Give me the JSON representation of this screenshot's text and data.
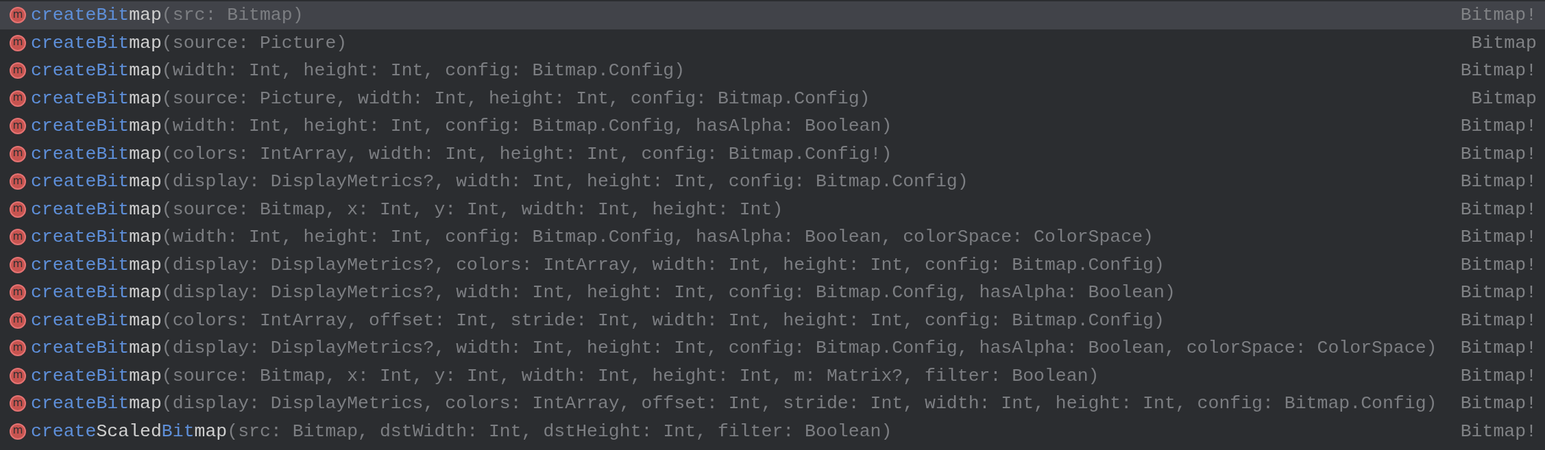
{
  "completion_list": {
    "items": [
      {
        "selected": true,
        "icon": "m",
        "name": [
          {
            "text": "createBit",
            "matched": true
          },
          {
            "text": "map",
            "matched": false
          }
        ],
        "params": "(src: Bitmap)",
        "type": "Bitmap!"
      },
      {
        "selected": false,
        "icon": "m",
        "name": [
          {
            "text": "createBit",
            "matched": true
          },
          {
            "text": "map",
            "matched": false
          }
        ],
        "params": "(source: Picture)",
        "type": "Bitmap"
      },
      {
        "selected": false,
        "icon": "m",
        "name": [
          {
            "text": "createBit",
            "matched": true
          },
          {
            "text": "map",
            "matched": false
          }
        ],
        "params": "(width: Int, height: Int, config: Bitmap.Config)",
        "type": "Bitmap!"
      },
      {
        "selected": false,
        "icon": "m",
        "name": [
          {
            "text": "createBit",
            "matched": true
          },
          {
            "text": "map",
            "matched": false
          }
        ],
        "params": "(source: Picture, width: Int, height: Int, config: Bitmap.Config)",
        "type": "Bitmap"
      },
      {
        "selected": false,
        "icon": "m",
        "name": [
          {
            "text": "createBit",
            "matched": true
          },
          {
            "text": "map",
            "matched": false
          }
        ],
        "params": "(width: Int, height: Int, config: Bitmap.Config, hasAlpha: Boolean)",
        "type": "Bitmap!"
      },
      {
        "selected": false,
        "icon": "m",
        "name": [
          {
            "text": "createBit",
            "matched": true
          },
          {
            "text": "map",
            "matched": false
          }
        ],
        "params": "(colors: IntArray, width: Int, height: Int, config: Bitmap.Config!)",
        "type": "Bitmap!"
      },
      {
        "selected": false,
        "icon": "m",
        "name": [
          {
            "text": "createBit",
            "matched": true
          },
          {
            "text": "map",
            "matched": false
          }
        ],
        "params": "(display: DisplayMetrics?, width: Int, height: Int, config: Bitmap.Config)",
        "type": "Bitmap!"
      },
      {
        "selected": false,
        "icon": "m",
        "name": [
          {
            "text": "createBit",
            "matched": true
          },
          {
            "text": "map",
            "matched": false
          }
        ],
        "params": "(source: Bitmap, x: Int, y: Int, width: Int, height: Int)",
        "type": "Bitmap!"
      },
      {
        "selected": false,
        "icon": "m",
        "name": [
          {
            "text": "createBit",
            "matched": true
          },
          {
            "text": "map",
            "matched": false
          }
        ],
        "params": "(width: Int, height: Int, config: Bitmap.Config, hasAlpha: Boolean, colorSpace: ColorSpace)",
        "type": "Bitmap!"
      },
      {
        "selected": false,
        "icon": "m",
        "name": [
          {
            "text": "createBit",
            "matched": true
          },
          {
            "text": "map",
            "matched": false
          }
        ],
        "params": "(display: DisplayMetrics?, colors: IntArray, width: Int, height: Int, config: Bitmap.Config)",
        "type": "Bitmap!"
      },
      {
        "selected": false,
        "icon": "m",
        "name": [
          {
            "text": "createBit",
            "matched": true
          },
          {
            "text": "map",
            "matched": false
          }
        ],
        "params": "(display: DisplayMetrics?, width: Int, height: Int, config: Bitmap.Config, hasAlpha: Boolean)",
        "type": "Bitmap!"
      },
      {
        "selected": false,
        "icon": "m",
        "name": [
          {
            "text": "createBit",
            "matched": true
          },
          {
            "text": "map",
            "matched": false
          }
        ],
        "params": "(colors: IntArray, offset: Int, stride: Int, width: Int, height: Int, config: Bitmap.Config)",
        "type": "Bitmap!"
      },
      {
        "selected": false,
        "icon": "m",
        "name": [
          {
            "text": "createBit",
            "matched": true
          },
          {
            "text": "map",
            "matched": false
          }
        ],
        "params": "(display: DisplayMetrics?, width: Int, height: Int, config: Bitmap.Config, hasAlpha: Boolean, colorSpace: ColorSpace)",
        "type": "Bitmap!"
      },
      {
        "selected": false,
        "icon": "m",
        "name": [
          {
            "text": "createBit",
            "matched": true
          },
          {
            "text": "map",
            "matched": false
          }
        ],
        "params": "(source: Bitmap, x: Int, y: Int, width: Int, height: Int, m: Matrix?, filter: Boolean)",
        "type": "Bitmap!"
      },
      {
        "selected": false,
        "icon": "m",
        "name": [
          {
            "text": "createBit",
            "matched": true
          },
          {
            "text": "map",
            "matched": false
          }
        ],
        "params": "(display: DisplayMetrics, colors: IntArray, offset: Int, stride: Int, width: Int, height: Int, config: Bitmap.Config)",
        "type": "Bitmap!"
      },
      {
        "selected": false,
        "icon": "m",
        "name": [
          {
            "text": "create",
            "matched": true
          },
          {
            "text": "Scaled",
            "matched": false
          },
          {
            "text": "Bit",
            "matched": true
          },
          {
            "text": "map",
            "matched": false
          }
        ],
        "params": "(src: Bitmap, dstWidth: Int, dstHeight: Int, filter: Boolean)",
        "type": "Bitmap!"
      }
    ]
  }
}
